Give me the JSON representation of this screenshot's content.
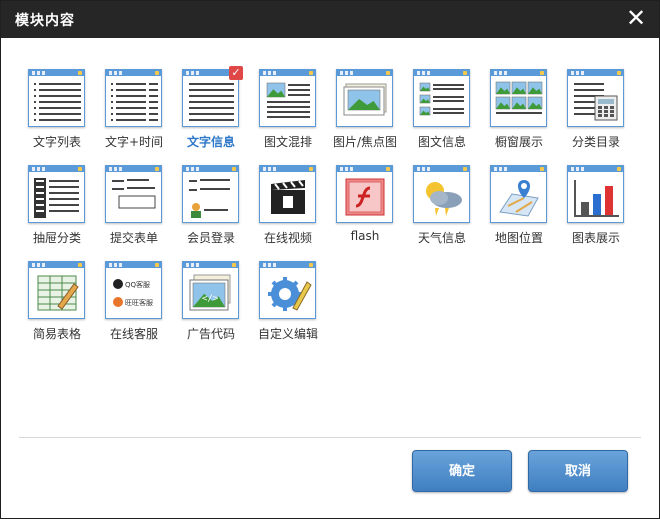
{
  "dialog": {
    "title": "模块内容",
    "close_glyph": "✕"
  },
  "modules": [
    {
      "label": "文字列表",
      "icon": "text-list-icon"
    },
    {
      "label": "文字+时间",
      "icon": "text-time-icon"
    },
    {
      "label": "文字信息",
      "icon": "text-info-icon",
      "selected": true
    },
    {
      "label": "图文混排",
      "icon": "image-text-mix-icon"
    },
    {
      "label": "图片/焦点图",
      "icon": "image-focus-icon"
    },
    {
      "label": "图文信息",
      "icon": "image-text-info-icon"
    },
    {
      "label": "橱窗展示",
      "icon": "showcase-icon"
    },
    {
      "label": "分类目录",
      "icon": "category-directory-icon"
    },
    {
      "label": "抽屉分类",
      "icon": "drawer-category-icon"
    },
    {
      "label": "提交表单",
      "icon": "submit-form-icon"
    },
    {
      "label": "会员登录",
      "icon": "member-login-icon"
    },
    {
      "label": "在线视频",
      "icon": "online-video-icon"
    },
    {
      "label": "flash",
      "icon": "flash-icon"
    },
    {
      "label": "天气信息",
      "icon": "weather-icon"
    },
    {
      "label": "地图位置",
      "icon": "map-location-icon"
    },
    {
      "label": "图表展示",
      "icon": "chart-display-icon"
    },
    {
      "label": "简易表格",
      "icon": "simple-table-icon"
    },
    {
      "label": "在线客服",
      "icon": "online-service-icon"
    },
    {
      "label": "广告代码",
      "icon": "ad-code-icon"
    },
    {
      "label": "自定义编辑",
      "icon": "custom-edit-icon"
    }
  ],
  "service_icon_text": {
    "qq": "QQ客服",
    "ww": "旺旺客服"
  },
  "ad_code_text": "</>",
  "check_glyph": "✓",
  "buttons": {
    "confirm": "确定",
    "cancel": "取消"
  },
  "colors": {
    "title_bar": "#262626",
    "accent_blue": "#5b9ad8",
    "selected_label": "#2f78c8",
    "check_red": "#e04848"
  }
}
